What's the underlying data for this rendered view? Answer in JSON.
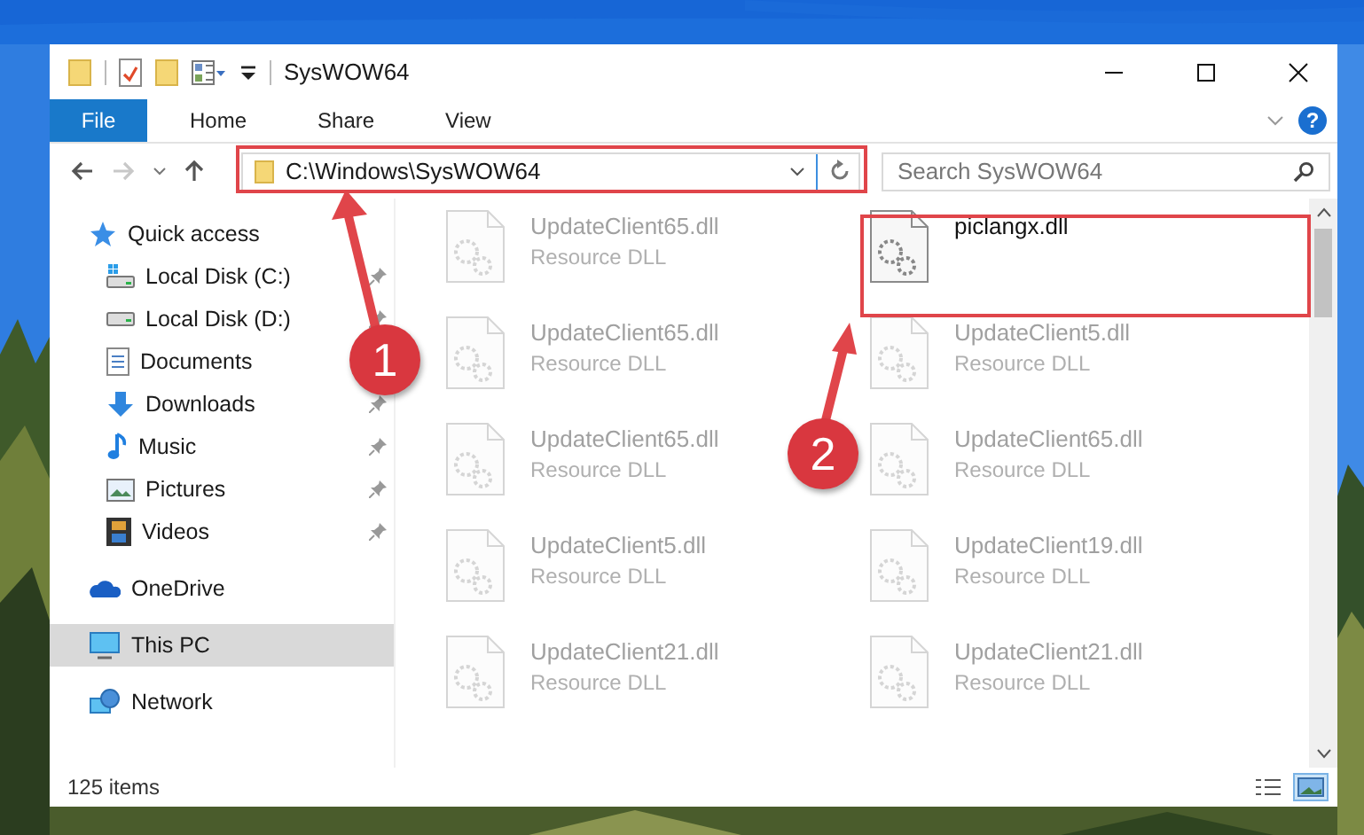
{
  "window": {
    "title": "SysWOW64"
  },
  "ribbon": {
    "tabs": [
      {
        "label": "File",
        "kind": "file",
        "selected": false
      },
      {
        "label": "Home",
        "kind": "tab",
        "selected": false
      },
      {
        "label": "Share",
        "kind": "tab",
        "selected": false
      },
      {
        "label": "View",
        "kind": "tab",
        "selected": false
      }
    ],
    "help_label": "?"
  },
  "nav": {
    "forward_disabled": true,
    "address": "C:\\Windows\\SysWOW64",
    "search": {
      "placeholder": "Search SysWOW64"
    }
  },
  "sidebar": {
    "items": [
      {
        "label": "Quick access",
        "selected": false,
        "children": [
          {
            "label": "Local Disk (C:)",
            "pinned": true,
            "selected": false
          },
          {
            "label": "Local Disk (D:)",
            "pinned": true,
            "selected": false
          },
          {
            "label": "Documents",
            "selected": false
          },
          {
            "label": "Downloads",
            "pinned": true,
            "selected": false
          },
          {
            "label": "Music",
            "pinned": true,
            "selected": false
          },
          {
            "label": "Pictures",
            "pinned": true,
            "selected": false
          },
          {
            "label": "Videos",
            "pinned": true,
            "selected": false
          }
        ]
      },
      {
        "label": "OneDrive",
        "selected": false
      },
      {
        "label": "This PC",
        "selected": true
      },
      {
        "label": "Network",
        "selected": false
      }
    ]
  },
  "files": [
    {
      "name": "UpdateClient65.dll",
      "type": "Resource DLL",
      "blurred": true
    },
    {
      "name": "piclangx.dll",
      "blurred": false
    },
    {
      "name": "UpdateClient65.dll",
      "type": "Resource DLL",
      "blurred": true
    },
    {
      "name": "UpdateClient5.dll",
      "type": "Resource DLL",
      "blurred": true
    },
    {
      "name": "UpdateClient65.dll",
      "type": "Resource DLL",
      "blurred": true
    },
    {
      "name": "UpdateClient65.dll",
      "type": "Resource DLL",
      "blurred": true
    },
    {
      "name": "UpdateClient5.dll",
      "type": "Resource DLL",
      "blurred": true
    },
    {
      "name": "UpdateClient19.dll",
      "type": "Resource DLL",
      "blurred": true
    },
    {
      "name": "UpdateClient21.dll",
      "type": "Resource DLL",
      "blurred": true
    },
    {
      "name": "UpdateClient21.dll",
      "type": "Resource DLL",
      "blurred": true
    }
  ],
  "status_bar": {
    "count": "125 items",
    "views": [
      {
        "kind": "details",
        "selected": false
      },
      {
        "kind": "large-icons",
        "selected": true
      }
    ]
  },
  "annotations": [
    {
      "label": "1"
    },
    {
      "label": "2"
    }
  ]
}
